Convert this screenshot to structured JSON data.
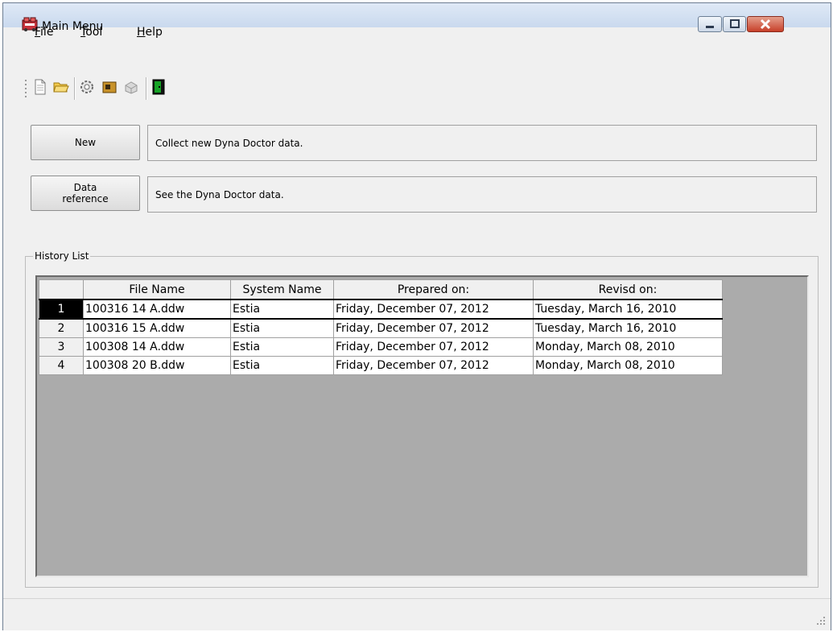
{
  "window": {
    "title": "Main Menu"
  },
  "menu": {
    "file": "File",
    "tool": "Tool",
    "help": "Help"
  },
  "actions": {
    "new_label": "New",
    "new_desc": "Collect new Dyna Doctor data.",
    "dataref_label_line1": "Data",
    "dataref_label_line2": "reference",
    "dataref_desc": "See the Dyna Doctor data."
  },
  "history": {
    "label": "History List",
    "columns": [
      "File Name",
      "System Name",
      "Prepared on:",
      "Revisd on:"
    ],
    "rows": [
      {
        "num": "1",
        "file": "100316  14  A.ddw",
        "system": "Estia",
        "prepared": "Friday, December 07, 2012",
        "revised": "Tuesday, March 16, 2010"
      },
      {
        "num": "2",
        "file": "100316  15  A.ddw",
        "system": "Estia",
        "prepared": "Friday, December 07, 2012",
        "revised": "Tuesday, March 16, 2010"
      },
      {
        "num": "3",
        "file": "100308  14  A.ddw",
        "system": "Estia",
        "prepared": "Friday, December 07, 2012",
        "revised": "Monday, March 08, 2010"
      },
      {
        "num": "4",
        "file": "100308  20  B.ddw",
        "system": "Estia",
        "prepared": "Friday, December 07, 2012",
        "revised": "Monday, March 08, 2010"
      }
    ]
  },
  "icons": {
    "app": "app-icon",
    "toolbar": [
      "new-document-icon",
      "open-folder-icon",
      "settings-gear-icon",
      "data-box-icon",
      "print-icon",
      "exit-door-icon"
    ]
  },
  "colors": {
    "close_button": "#c7402a",
    "grid_background": "#ababab",
    "selected_row_header": "#000000"
  }
}
